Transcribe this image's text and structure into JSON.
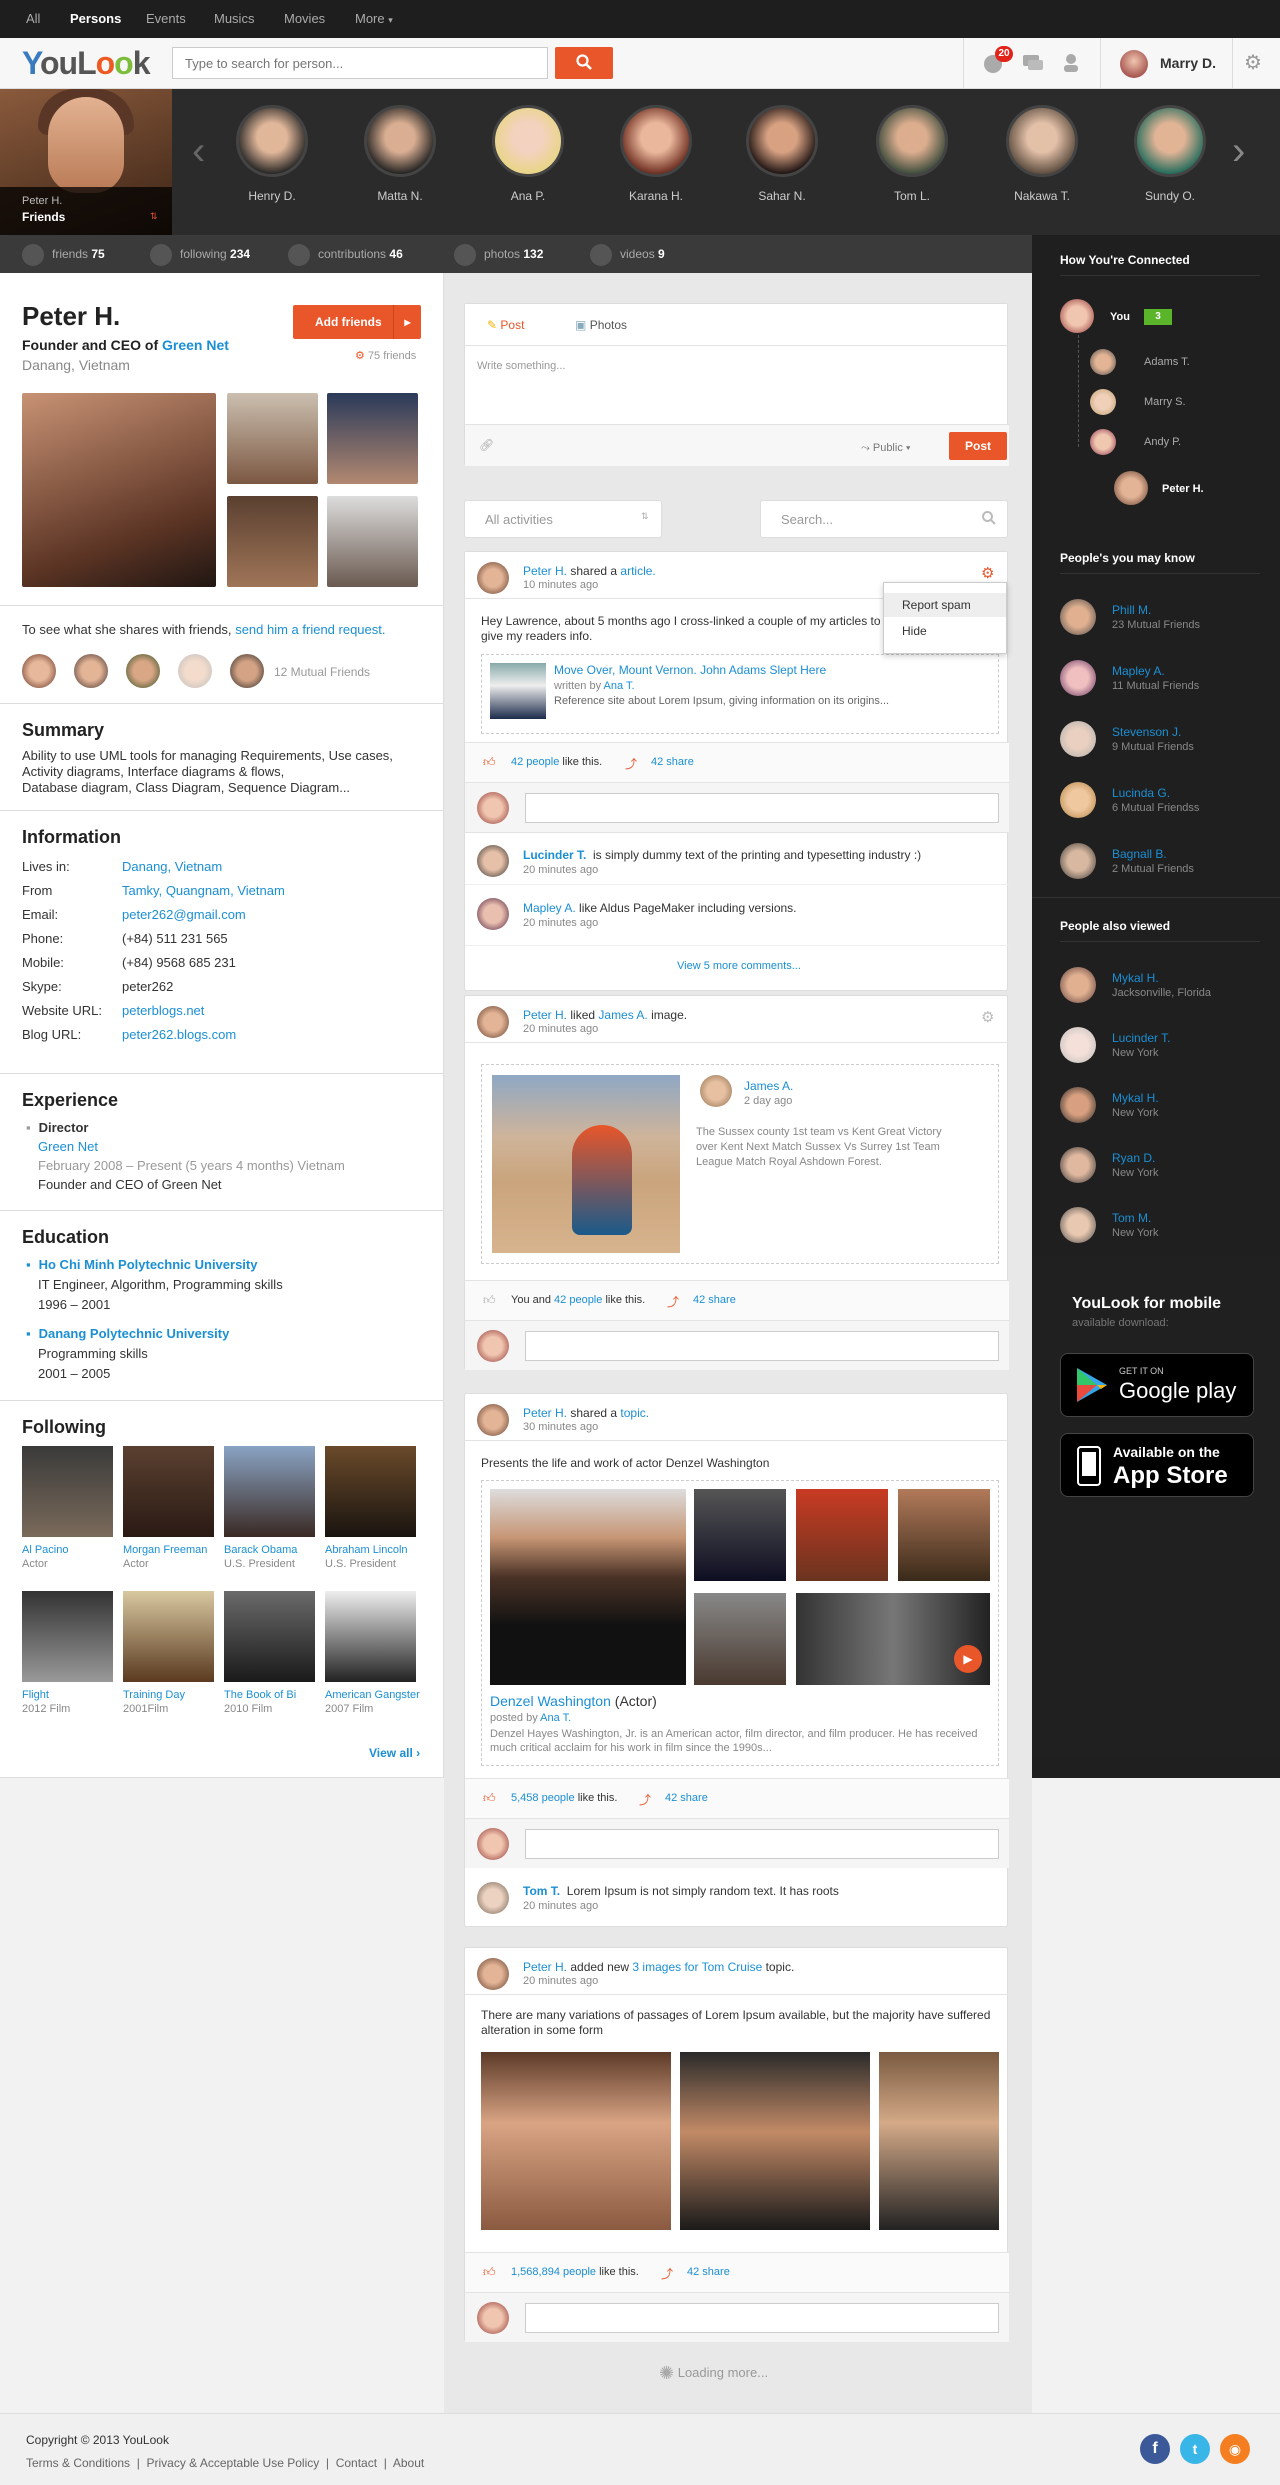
{
  "nav": {
    "items": [
      "All",
      "Persons",
      "Events",
      "Musics",
      "Movies",
      "More"
    ]
  },
  "header": {
    "logo": "YouLook",
    "search_placeholder": "Type to search for person...",
    "notif_count": "20",
    "user": "Marry D."
  },
  "strip": {
    "main_name": "Peter H.",
    "main_label": "Friends",
    "friends": [
      "Henry D.",
      "Matta N.",
      "Ana P.",
      "Karana H.",
      "Sahar N.",
      "Tom L.",
      "Nakawa T.",
      "Sundy O."
    ]
  },
  "stats": [
    {
      "label": "friends",
      "value": "75"
    },
    {
      "label": "following",
      "value": "234"
    },
    {
      "label": "contributions",
      "value": "46"
    },
    {
      "label": "photos",
      "value": "132"
    },
    {
      "label": "videos",
      "value": "9"
    }
  ],
  "profile": {
    "name": "Peter H.",
    "role_prefix": "Founder and CEO of",
    "company": "Green Net",
    "location": "Danang, Vietnam",
    "add_button": "Add friends",
    "friend_count": "75 friends",
    "share_text": "To see what she shares with friends,",
    "share_link": "send him a friend request.",
    "mutual": "12 Mutual Friends"
  },
  "summary": {
    "title": "Summary",
    "text1": "Ability to use UML tools for managing Requirements, Use cases,",
    "text2": "Activity diagrams, Interface diagrams & flows,",
    "text3": "Database diagram, Class Diagram, Sequence Diagram..."
  },
  "information": {
    "title": "Information",
    "rows": [
      {
        "k": "Lives in:",
        "v": "Danang, Vietnam"
      },
      {
        "k": "From",
        "v": "Tamky, Quangnam, Vietnam"
      },
      {
        "k": "Email:",
        "v": "peter262@gmail.com"
      },
      {
        "k": "Phone:",
        "v": "(+84) 511 231 565"
      },
      {
        "k": "Mobile:",
        "v": "(+84) 9568 685 231"
      },
      {
        "k": "Skype:",
        "v": "peter262"
      },
      {
        "k": "Website URL:",
        "v": "peterblogs.net"
      },
      {
        "k": "Blog URL:",
        "v": "peter262.blogs.com"
      }
    ]
  },
  "experience": {
    "title": "Experience",
    "position": "Director",
    "company": "Green Net",
    "period": "February 2008 – Present (5 years 4 months) Vietnam",
    "desc": "Founder and CEO of Green Net"
  },
  "education": {
    "title": "Education",
    "items": [
      {
        "school": "Ho Chi Minh Polytechnic University",
        "line1": "IT Engineer, Algorithm, Programming skills",
        "line2": "1996 – 2001"
      },
      {
        "school": "Danang Polytechnic University",
        "line1": "Programming skills",
        "line2": "2001 – 2005"
      }
    ]
  },
  "following": {
    "title": "Following",
    "items": [
      {
        "n": "Al Pacino",
        "s": "Actor"
      },
      {
        "n": "Morgan Freeman",
        "s": "Actor"
      },
      {
        "n": "Barack Obama",
        "s": "U.S. President"
      },
      {
        "n": "Abraham Lincoln",
        "s": "U.S. President"
      },
      {
        "n": "Flight",
        "s": "2012 Film"
      },
      {
        "n": "Training Day",
        "s": "2001Film"
      },
      {
        "n": "The Book of Bi",
        "s": "2010 Film"
      },
      {
        "n": "American Gangster",
        "s": "2007 Film"
      }
    ],
    "view_all": "View all ›"
  },
  "composer": {
    "tab_post": "Post",
    "tab_photos": "Photos",
    "placeholder": "Write something...",
    "privacy": "Public",
    "post_btn": "Post"
  },
  "filter": {
    "select": "All activities",
    "search": "Search..."
  },
  "post1": {
    "author": "Peter H.",
    "action": "shared a",
    "obj": "article.",
    "time": "10 minutes ago",
    "text1": "Hey Lawrence, about 5 months ago I cross-linked a couple of my articles to",
    "text2": "give my readers info.",
    "menu": [
      "Report spam",
      "Hide"
    ],
    "article_title": "Move Over, Mount Vernon. John Adams Slept Here",
    "written": "written by",
    "writer": "Ana T.",
    "article_desc": "Reference site about Lorem Ipsum, giving information on its origins...",
    "likes": "42 people",
    "like_suffix": "like this.",
    "share": "42 share",
    "c1_name": "Lucinder T.",
    "c1_text": "is simply dummy text of the printing and typesetting industry :)",
    "c1_time": "20 minutes ago",
    "c2_name": "Mapley A.",
    "c2_text": "like Aldus PageMaker including versions.",
    "c2_time": "20 minutes ago",
    "more": "View 5 more comments..."
  },
  "post2": {
    "author": "Peter H.",
    "action": "liked",
    "who": "James A.",
    "obj": "image.",
    "time": "20 minutes ago",
    "inner_name": "James A.",
    "inner_time": "2 day ago",
    "inner_text1": "The Sussex county 1st team vs Kent Great Victory",
    "inner_text2": "over Kent Next Match Sussex Vs Surrey 1st Team",
    "inner_text3": "League Match Royal Ashdown Forest.",
    "you": "You and",
    "likes": "42 people",
    "like_suffix": "like this.",
    "share": "42 share"
  },
  "post3": {
    "author": "Peter H.",
    "action": "shared a",
    "obj": "topic.",
    "time": "30 minutes ago",
    "text": "Presents the life and work of actor Denzel Washington",
    "topic": "Denzel Washington",
    "topic_suffix": "(Actor)",
    "posted": "posted by",
    "poster": "Ana T.",
    "desc1": "Denzel Hayes Washington, Jr. is an American actor, film director, and film producer. He has received",
    "desc2": "much critical acclaim for his work in film since the 1990s...",
    "likes": "5,458 people",
    "like_suffix": "like this.",
    "share": "42 share",
    "c_name": "Tom T.",
    "c_text": "Lorem Ipsum is not simply random text. It has roots",
    "c_time": "20 minutes ago"
  },
  "post4": {
    "author": "Peter H.",
    "action": "added new",
    "obj": "3 images for Tom Cruise",
    "suffix": "topic.",
    "time": "20 minutes ago",
    "text1": "There are many variations of passages of Lorem Ipsum available, but the majority have suffered",
    "text2": "alteration in some form",
    "likes": "1,568,894 people",
    "like_suffix": "like this.",
    "share": "42 share"
  },
  "loading": "Loading more...",
  "right": {
    "connected_title": "How You're Connected",
    "you": "You",
    "degree": "3",
    "chain": [
      "Adams T.",
      "Marry S.",
      "Andy P.",
      "Peter H."
    ],
    "know_title": "People's you may know",
    "know": [
      {
        "n": "Phill M.",
        "s": "23 Mutual Friends"
      },
      {
        "n": "Mapley A.",
        "s": "11 Mutual Friends"
      },
      {
        "n": "Stevenson J.",
        "s": "9 Mutual Friends"
      },
      {
        "n": "Lucinda G.",
        "s": "6 Mutual Friendss"
      },
      {
        "n": "Bagnall B.",
        "s": "2 Mutual Friends"
      }
    ],
    "viewed_title": "People also viewed",
    "viewed": [
      {
        "n": "Mykal H.",
        "s": "Jacksonville, Florida"
      },
      {
        "n": "Lucinder T.",
        "s": "New York"
      },
      {
        "n": "Mykal H.",
        "s": "New York"
      },
      {
        "n": "Ryan D.",
        "s": "New York"
      },
      {
        "n": "Tom M.",
        "s": "New York"
      }
    ],
    "mobile_title": "YouLook for mobile",
    "mobile_sub": "available download:",
    "gp_small": "GET IT ON",
    "gp_big": "Google play",
    "as_small": "Available on the",
    "as_big": "App Store"
  },
  "footer": {
    "copyright": "Copyright © 2013 YouLook",
    "links": [
      "Terms & Conditions",
      "Privacy & Acceptable Use Policy",
      "Contact",
      "About"
    ]
  }
}
